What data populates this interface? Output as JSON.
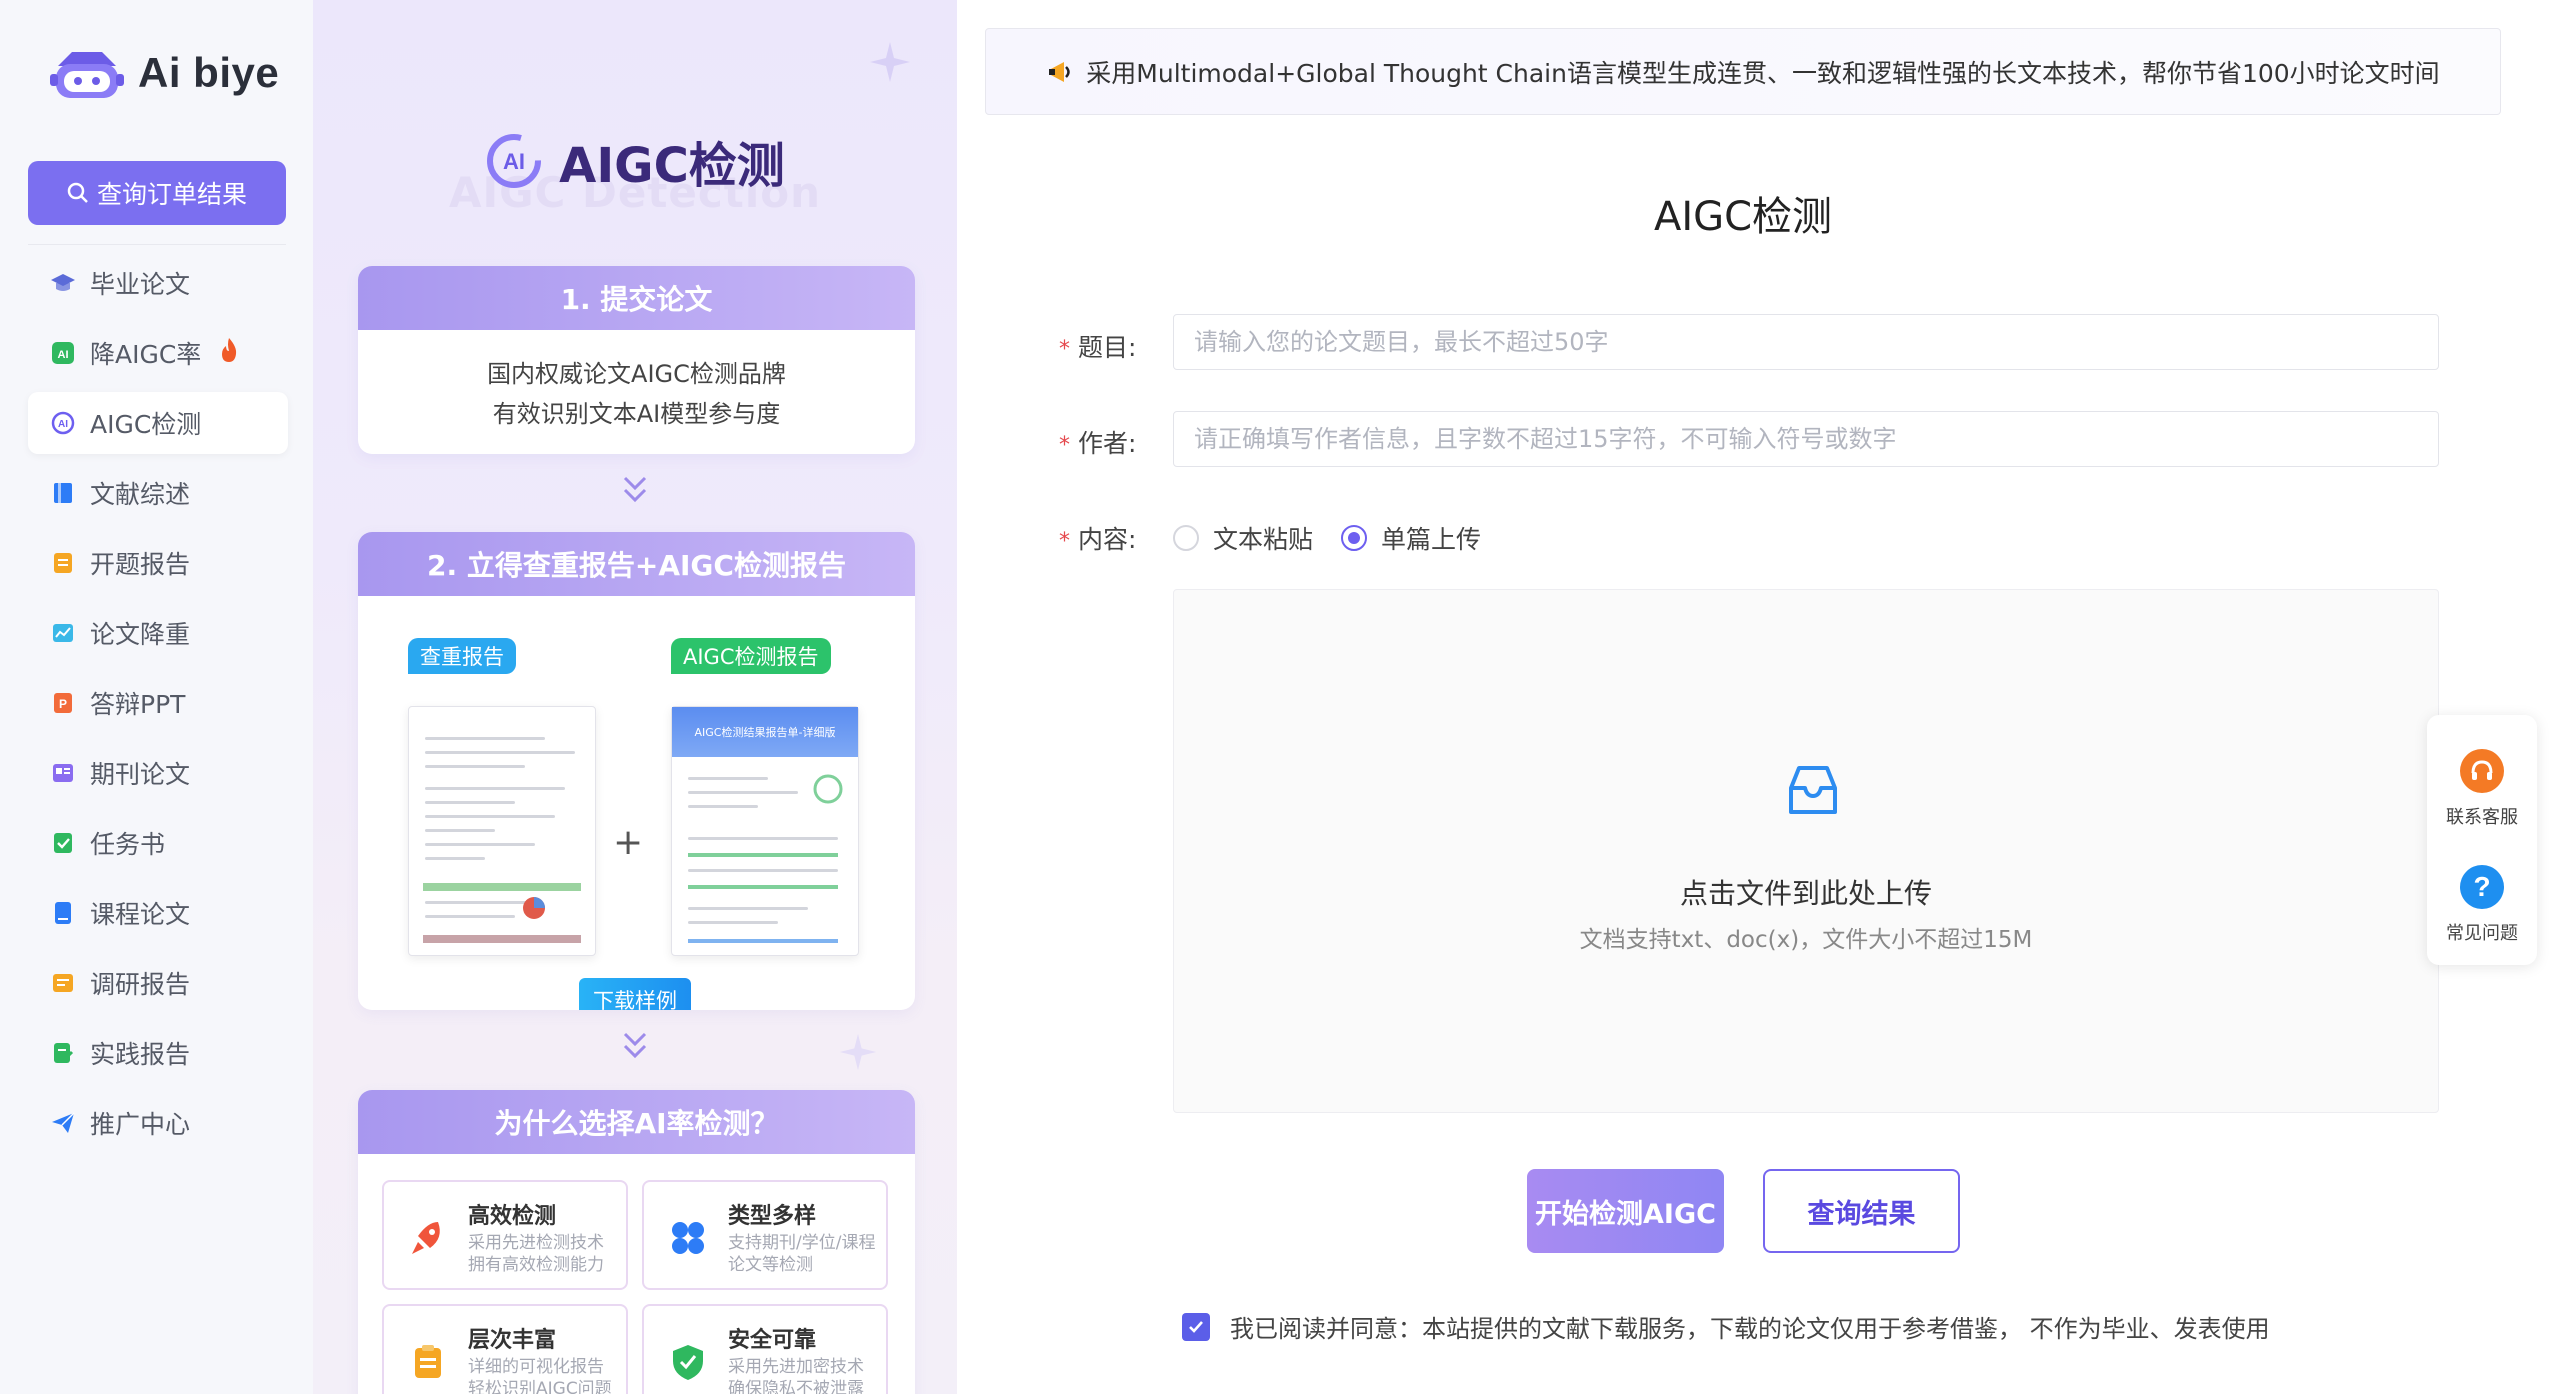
{
  "brand": {
    "name": "Ai biye"
  },
  "sidebar": {
    "order_button": "查询订单结果",
    "items": [
      {
        "label": "毕业论文",
        "icon": "graduation-cap-icon",
        "color": "#5b6bd8"
      },
      {
        "label": "降AIGC率",
        "icon": "ai-badge-icon",
        "color": "#2fb85f"
      },
      {
        "label": "AIGC检测",
        "icon": "ai-scan-icon",
        "color": "#6d5ff0",
        "active": true
      },
      {
        "label": "文献综述",
        "icon": "book-icon",
        "color": "#2d7cf6"
      },
      {
        "label": "开题报告",
        "icon": "document-icon",
        "color": "#f5a623"
      },
      {
        "label": "论文降重",
        "icon": "chart-icon",
        "color": "#3ab8e8"
      },
      {
        "label": "答辩PPT",
        "icon": "ppt-icon",
        "color": "#f26b3a"
      },
      {
        "label": "期刊论文",
        "icon": "journal-icon",
        "color": "#8a6cf0"
      },
      {
        "label": "任务书",
        "icon": "checklist-icon",
        "color": "#2fb85f"
      },
      {
        "label": "课程论文",
        "icon": "notebook-icon",
        "color": "#2d7cf6"
      },
      {
        "label": "调研报告",
        "icon": "survey-icon",
        "color": "#f5a623"
      },
      {
        "label": "实践报告",
        "icon": "edit-doc-icon",
        "color": "#2fb85f"
      },
      {
        "label": "推广中心",
        "icon": "paper-plane-icon",
        "color": "#2d7cf6"
      }
    ]
  },
  "promo": {
    "title": "AIGC检测",
    "ghost_title": "AIGC Detection",
    "step1": {
      "heading": "1. 提交论文",
      "line1": "国内权威论文AIGC检测品牌",
      "line2": "有效识别文本AI模型参与度"
    },
    "step2": {
      "heading": "2. 立得查重报告+AIGC检测报告",
      "tag_left": "查重报告",
      "tag_right": "AIGC检测报告",
      "right_doc_header": "AIGC检测结果报告单-详细版",
      "plus": "+",
      "download": "下载样例"
    },
    "step3": {
      "heading": "为什么选择AI率检测？",
      "features": [
        {
          "title": "高效检测",
          "desc": "采用先进检测技术拥有高效检测能力",
          "icon": "rocket-icon",
          "color": "#f0553b"
        },
        {
          "title": "类型多样",
          "desc": "支持期刊/学位/课程论文等检测",
          "icon": "grid-icon",
          "color": "#2d7cf6"
        },
        {
          "title": "层次丰富",
          "desc": "详细的可视化报告轻松识别AIGC问题",
          "icon": "clipboard-icon",
          "color": "#f5a623"
        },
        {
          "title": "安全可靠",
          "desc": "采用先进加密技术确保隐私不被泄露",
          "icon": "shield-check-icon",
          "color": "#2fb85f"
        }
      ]
    }
  },
  "main": {
    "notice": "采用Multimodal+Global Thought Chain语言模型生成连贯、一致和逻辑性强的长文本技术，帮你节省100小时论文时间",
    "title": "AIGC检测",
    "fields": {
      "topic_label": "题目:",
      "topic_placeholder": "请输入您的论文题目，最长不超过50字",
      "author_label": "作者:",
      "author_placeholder": "请正确填写作者信息，且字数不超过15字符，不可输入符号或数字",
      "content_label": "内容:",
      "required_mark": "*"
    },
    "content_options": [
      {
        "label": "文本粘贴",
        "checked": false
      },
      {
        "label": "单篇上传",
        "checked": true
      }
    ],
    "upload": {
      "main_text": "点击文件到此处上传",
      "sub_text": "文档支持txt、doc(x)，文件大小不超过15M"
    },
    "buttons": {
      "start": "开始检测AIGC",
      "query": "查询结果"
    },
    "agreement": {
      "checked": true,
      "text": "我已阅读并同意：本站提供的文献下载服务，下载的论文仅用于参考借鉴， 不作为毕业、发表使用"
    }
  },
  "float": {
    "service": "联系客服",
    "faq": "常见问题"
  },
  "colors": {
    "accent": "#6d5ff0",
    "button": "#7b6ff0",
    "danger": "#e5484d"
  }
}
